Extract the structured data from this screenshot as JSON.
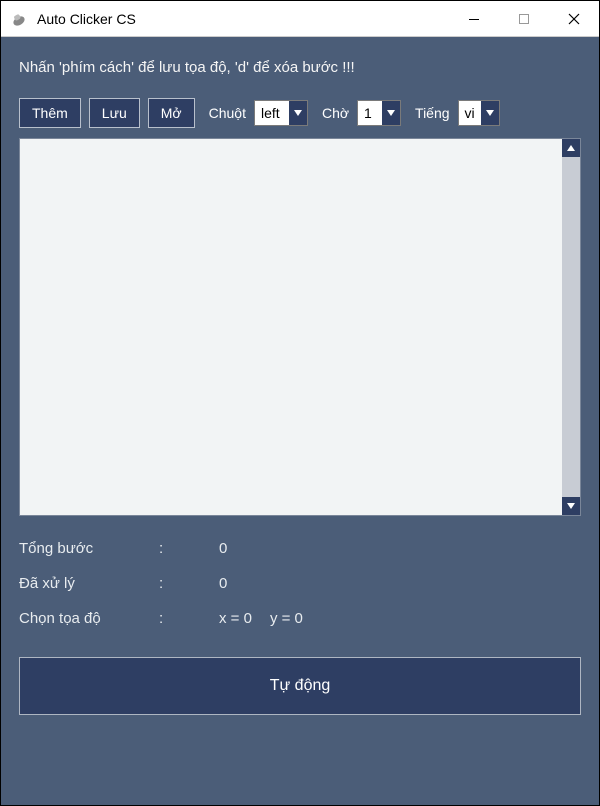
{
  "window": {
    "title": "Auto Clicker CS"
  },
  "instruction": "Nhấn 'phím cách' để lưu tọa độ, 'd' để xóa bước !!!",
  "toolbar": {
    "add_label": "Thêm",
    "save_label": "Lưu",
    "open_label": "Mở",
    "mouse_label": "Chuột",
    "mouse_value": "left",
    "wait_label": "Chờ",
    "wait_value": "1",
    "lang_label": "Tiếng",
    "lang_value": "vi"
  },
  "stats": {
    "total_label": "Tổng bước",
    "total_value": "0",
    "processed_label": "Đã xử lý",
    "processed_value": "0",
    "coord_label": "Chọn tọa độ",
    "coord_x_label": "x = 0",
    "coord_y_label": "y = 0",
    "colon": ":"
  },
  "auto_button": "Tự động"
}
